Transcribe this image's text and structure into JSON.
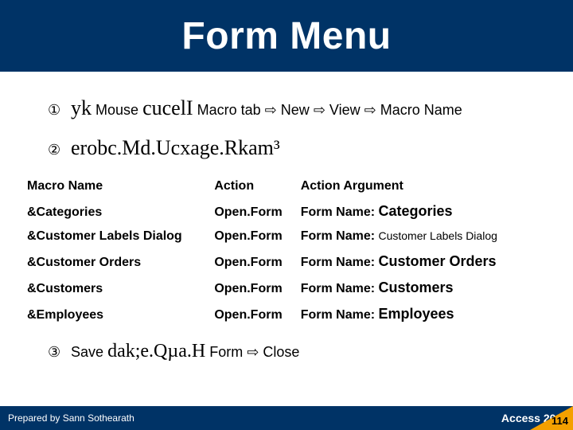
{
  "title": "Form Menu",
  "step1": {
    "bullet": "①",
    "t1": "yk",
    "t2": "Mouse",
    "t3": "cucelI",
    "t4": "Macro tab",
    "arrow": "⇨",
    "t5": "New",
    "t6": "View",
    "t7": "Macro Name"
  },
  "step2": {
    "bullet": "②",
    "text": "erobc.Md.Ucxage.Rkam³"
  },
  "table": {
    "headers": {
      "c1": "Macro Name",
      "c2": "Action",
      "c3": "Action Argument"
    },
    "arg_label": "Form Name:",
    "rows": [
      {
        "name": "&Categories",
        "action": "Open.Form",
        "arg": "Categories",
        "big": true
      },
      {
        "name": "&Customer Labels Dialog",
        "action": "Open.Form",
        "arg": "Customer Labels Dialog",
        "big": false
      },
      {
        "name": "&Customer Orders",
        "action": "Open.Form",
        "arg": "Customer Orders",
        "big": true
      },
      {
        "name": "&Customers",
        "action": "Open.Form",
        "arg": "Customers",
        "big": true
      },
      {
        "name": "&Employees",
        "action": "Open.Form",
        "arg": "Employees",
        "big": true
      }
    ]
  },
  "step3": {
    "bullet": "③",
    "t1": "Save",
    "t2": "dak;e.Qµa.H",
    "t3": "Form",
    "arrow": "⇨",
    "t4": "Close"
  },
  "footer": {
    "prepared": "Prepared by Sann Sothearath",
    "product": "Access 2003",
    "page": "114"
  }
}
